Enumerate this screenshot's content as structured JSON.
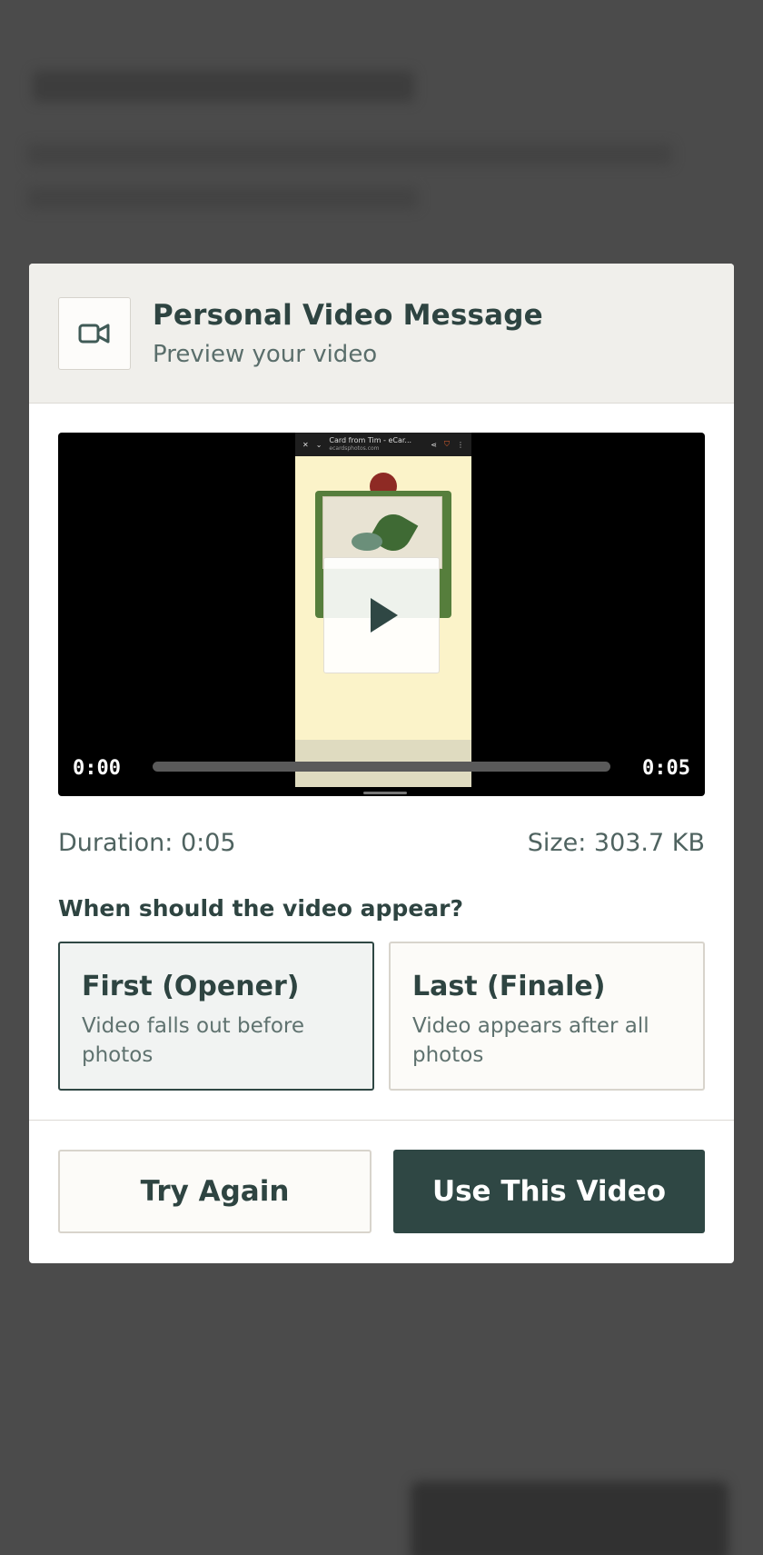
{
  "modal": {
    "icon": "video-camera-icon",
    "title": "Personal Video Message",
    "subtitle": "Preview your video"
  },
  "video": {
    "current_time": "0:00",
    "duration_time": "0:05",
    "play_icon": "play-icon",
    "progress": 0,
    "embedded_tab_title": "Card from Tim - eCar...",
    "embedded_url": "ecardsphotos.com"
  },
  "meta": {
    "duration": "Duration: 0:05",
    "size": "Size: 303.7 KB"
  },
  "placement": {
    "question": "When should the video appear?",
    "options": [
      {
        "title": "First (Opener)",
        "description": "Video falls out before photos",
        "selected": true
      },
      {
        "title": "Last (Finale)",
        "description": "Video appears after all photos",
        "selected": false
      }
    ]
  },
  "actions": {
    "try_again": "Try Again",
    "use_video": "Use This Video"
  },
  "colors": {
    "primary": "#2f4744",
    "header_bg": "#f0efeb",
    "backdrop": "#535353"
  }
}
